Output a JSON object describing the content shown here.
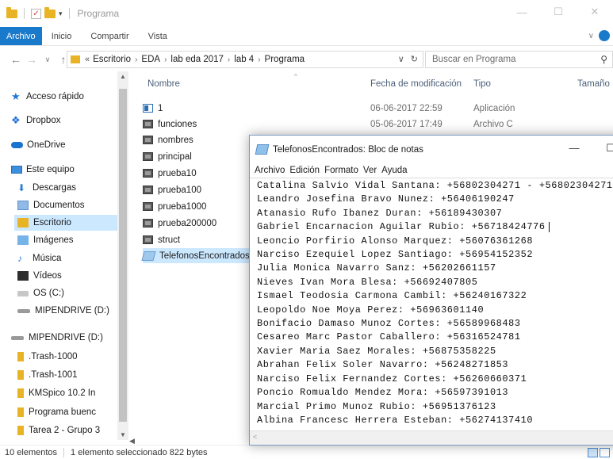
{
  "window": {
    "title": "Programa",
    "controls": {
      "minimize": "—",
      "maximize": "☐",
      "close": "✕"
    }
  },
  "ribbon": {
    "tabs": [
      {
        "label": "Archivo",
        "active": true
      },
      {
        "label": "Inicio",
        "active": false
      },
      {
        "label": "Compartir",
        "active": false
      },
      {
        "label": "Vista",
        "active": false
      }
    ]
  },
  "address": {
    "lead": "«",
    "breadcrumbs": [
      "Escritorio",
      "EDA",
      "lab eda 2017",
      "lab 4",
      "Programa"
    ],
    "search_placeholder": "Buscar en Programa"
  },
  "nav_pane": {
    "items": [
      {
        "label": "Acceso rápido",
        "icon": "star-icon"
      },
      {
        "label": "Dropbox",
        "icon": "dropbox-icon"
      },
      {
        "label": "OneDrive",
        "icon": "cloud-icon"
      },
      {
        "label": "Este equipo",
        "icon": "computer-icon"
      },
      {
        "label": "Descargas",
        "icon": "download-icon"
      },
      {
        "label": "Documentos",
        "icon": "documents-icon"
      },
      {
        "label": "Escritorio",
        "icon": "folder-icon",
        "selected": true
      },
      {
        "label": "Imágenes",
        "icon": "pictures-icon"
      },
      {
        "label": "Música",
        "icon": "music-icon"
      },
      {
        "label": "Vídeos",
        "icon": "video-icon"
      },
      {
        "label": "OS (C:)",
        "icon": "drive-icon"
      },
      {
        "label": "MIPENDRIVE (D:)",
        "icon": "usb-drive-icon"
      },
      {
        "label": "MIPENDRIVE (D:)",
        "icon": "usb-drive-icon"
      },
      {
        "label": ".Trash-1000",
        "icon": "folder-icon"
      },
      {
        "label": ".Trash-1001",
        "icon": "folder-icon"
      },
      {
        "label": "KMSpico 10.2 In",
        "icon": "folder-icon"
      },
      {
        "label": "Programa buenc",
        "icon": "folder-icon"
      },
      {
        "label": "Tarea 2 - Grupo 3",
        "icon": "folder-icon"
      }
    ]
  },
  "file_list": {
    "columns": [
      "Nombre",
      "Fecha de modificación",
      "Tipo",
      "Tamaño"
    ],
    "rows": [
      {
        "name": "1",
        "date": "06-06-2017 22:59",
        "type": "Aplicación",
        "icon": "app-icon"
      },
      {
        "name": "funciones",
        "date": "05-06-2017 17:49",
        "type": "Archivo C",
        "icon": "c-file-icon"
      },
      {
        "name": "nombres",
        "date": "",
        "type": "",
        "icon": "c-file-icon"
      },
      {
        "name": "principal",
        "date": "",
        "type": "",
        "icon": "c-file-icon"
      },
      {
        "name": "prueba10",
        "date": "",
        "type": "",
        "icon": "c-file-icon"
      },
      {
        "name": "prueba100",
        "date": "",
        "type": "",
        "icon": "c-file-icon"
      },
      {
        "name": "prueba1000",
        "date": "",
        "type": "",
        "icon": "c-file-icon"
      },
      {
        "name": "prueba200000",
        "date": "",
        "type": "",
        "icon": "c-file-icon"
      },
      {
        "name": "struct",
        "date": "",
        "type": "",
        "icon": "c-file-icon"
      },
      {
        "name": "TelefonosEncontrados",
        "date": "",
        "type": "",
        "icon": "text-file-icon",
        "selected": true
      }
    ]
  },
  "status": {
    "count": "10 elementos",
    "selection": "1 elemento seleccionado  822 bytes"
  },
  "notepad": {
    "title": "TelefonosEncontrados: Bloc de notas",
    "menu": [
      "Archivo",
      "Edición",
      "Formato",
      "Ver",
      "Ayuda"
    ],
    "lines": [
      "Catalina Salvio Vidal Santana: +56802304271 - +56802304271",
      "Leandro Josefina Bravo Nunez: +56406190247",
      "Atanasio Rufo Ibanez Duran: +56189430307",
      "Gabriel Encarnacion Aguilar Rubio: +56718424776",
      "Leoncio Porfirio Alonso Marquez: +56076361268",
      "Narciso Ezequiel Lopez Santiago: +56954152352",
      "Julia Monica Navarro Sanz: +56202661157",
      "Nieves Ivan Mora Blesa: +56692407805",
      "Ismael Teodosia Carmona Cambil: +56240167322",
      "Leopoldo Noe Moya Perez: +56963601140",
      "Bonifacio Damaso Munoz Cortes: +56589968483",
      "Cesareo Marc Pastor Caballero: +56316524781",
      "Xavier Maria Saez Morales: +56875358225",
      "Abrahan Felix Soler Navarro: +56248271853",
      "Narciso Felix Fernandez Cortes: +56260660371",
      "Poncio Romualdo Mendez Mora: +56597391013",
      "Marcial Primo Munoz Rubio: +56951376123",
      "Albina Francesc Herrera Esteban: +56274137410"
    ],
    "caret_line": 3
  },
  "colors": {
    "accent": "#1979ca",
    "selection": "#cce8ff",
    "folder": "#e8b425"
  }
}
